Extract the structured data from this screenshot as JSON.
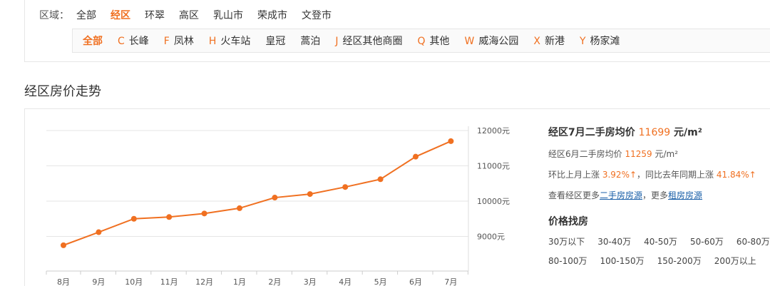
{
  "region": {
    "label": "区域",
    "colon": "：",
    "options": [
      "全部",
      "经区",
      "环翠",
      "高区",
      "乳山市",
      "荣成市",
      "文登市"
    ],
    "active_index": 1
  },
  "subareas": [
    {
      "letter": "",
      "name": "全部",
      "active": true
    },
    {
      "letter": "C",
      "name": "长峰"
    },
    {
      "letter": "F",
      "name": "凤林"
    },
    {
      "letter": "H",
      "name": "火车站"
    },
    {
      "letter": "",
      "name": "皇冠"
    },
    {
      "letter": "",
      "name": "蒿泊"
    },
    {
      "letter": "J",
      "name": "经区其他商圈"
    },
    {
      "letter": "Q",
      "name": "其他"
    },
    {
      "letter": "W",
      "name": "威海公园"
    },
    {
      "letter": "X",
      "name": "新港"
    },
    {
      "letter": "Y",
      "name": "杨家滩"
    }
  ],
  "section_title": "经区房价走势",
  "colors": {
    "accent": "#f07021",
    "link": "#1a5fa8",
    "grid": "#e6e6e6"
  },
  "chart_data": {
    "type": "line",
    "categories": [
      "8月",
      "9月",
      "10月",
      "11月",
      "12月",
      "1月",
      "2月",
      "3月",
      "4月",
      "5月",
      "6月",
      "7月"
    ],
    "series": [
      {
        "values": [
          8750,
          9120,
          9500,
          9550,
          9650,
          9800,
          10100,
          10200,
          10400,
          10620,
          11259,
          11699
        ]
      }
    ],
    "y_ticks": [
      "9000元",
      "10000元",
      "11000元",
      "12000元"
    ],
    "ylim": [
      8200,
      12000
    ],
    "grid": true
  },
  "info": {
    "headline_prefix": "经区7月二手房均价",
    "headline_value": "11699",
    "headline_unit": "元/m²",
    "june_prefix": "经区6月二手房均价",
    "june_value": "11259",
    "june_unit": "元/m²",
    "mom_prefix": "环比上月上涨",
    "mom_value": "3.92%",
    "arrow": "↑",
    "yoy_prefix": "，同比去年同期上涨",
    "yoy_value": "41.84%",
    "more_prefix": "查看经区更多",
    "link_secondhand": "二手房房源",
    "more_middle": "，更多",
    "link_rent": "租房房源",
    "price_title": "价格找房",
    "price_ranges": [
      "30万以下",
      "30-40万",
      "40-50万",
      "50-60万",
      "60-80万",
      "80-100万",
      "100-150万",
      "150-200万",
      "200万以上"
    ]
  }
}
